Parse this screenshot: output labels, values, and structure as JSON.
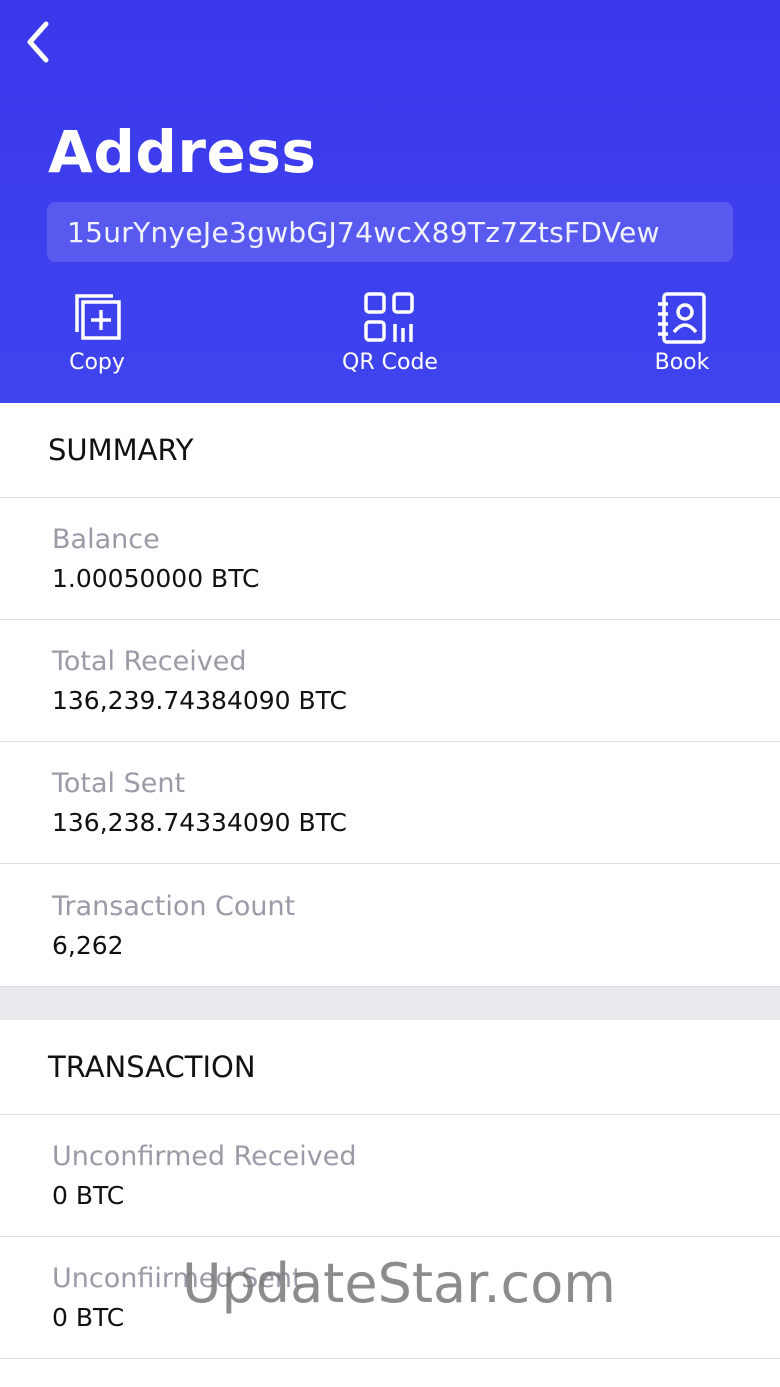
{
  "header": {
    "title": "Address",
    "address": "15urYnyeJe3gwbGJ74wcX89Tz7ZtsFDVew",
    "background_color": "#3d3fee",
    "actions": [
      {
        "label": "Copy",
        "icon": "copy-add-icon"
      },
      {
        "label": "QR Code",
        "icon": "qr-code-icon"
      },
      {
        "label": "Book",
        "icon": "address-book-icon"
      }
    ]
  },
  "summary": {
    "heading": "SUMMARY",
    "rows": [
      {
        "label": "Balance",
        "value": "1.00050000 BTC"
      },
      {
        "label": "Total Received",
        "value": "136,239.74384090 BTC"
      },
      {
        "label": "Total Sent",
        "value": "136,238.74334090 BTC"
      },
      {
        "label": "Transaction Count",
        "value": "6,262"
      }
    ]
  },
  "transaction": {
    "heading": "TRANSACTION",
    "rows": [
      {
        "label": "Unconfirmed Received",
        "value": "0 BTC"
      },
      {
        "label": "Unconfiirmed Sent",
        "value": "0 BTC"
      }
    ]
  },
  "watermark": "UpdateStar.com"
}
